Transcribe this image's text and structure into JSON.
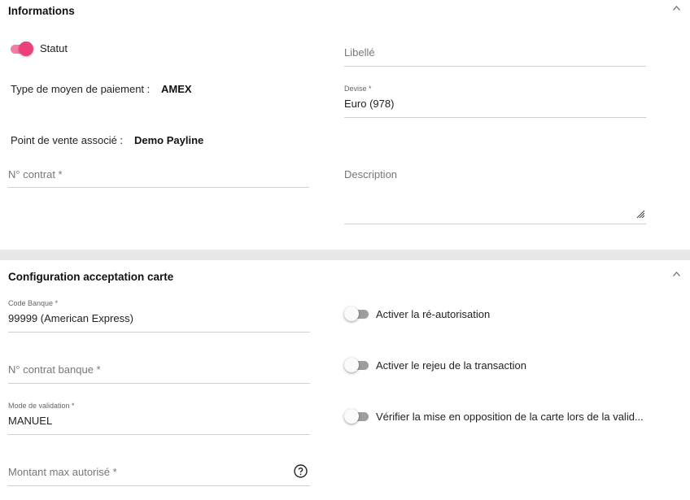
{
  "informations": {
    "title": "Informations",
    "statut_label": "Statut",
    "statut_on": true,
    "type_label": "Type de moyen de paiement :",
    "type_value": "AMEX",
    "pos_label": "Point de vente associé :",
    "pos_value": "Demo Payline",
    "contrat_placeholder": "N° contrat *",
    "libelle_placeholder": "Libellé",
    "devise_label": "Devise *",
    "devise_value": "Euro (978)",
    "description_placeholder": "Description"
  },
  "config": {
    "title": "Configuration acceptation carte",
    "code_banque_label": "Code Banque *",
    "code_banque_value": "99999 (American Express)",
    "contrat_banque_placeholder": "N° contrat banque *",
    "mode_label": "Mode de validation *",
    "mode_value": "MANUEL",
    "montant_placeholder": "Montant max autorisé *",
    "toggles": [
      {
        "label": "Activer la ré-autorisation",
        "on": false
      },
      {
        "label": "Activer le rejeu de la transaction",
        "on": false
      },
      {
        "label": "Vérifier la mise en opposition de la carte lors de la valid...",
        "on": false
      }
    ]
  },
  "colors": {
    "accent": "#ec407a",
    "separator": "#e6e7e6"
  },
  "icons": [
    "chevron-up-icon",
    "resize-handle-icon",
    "help-circle-icon"
  ]
}
